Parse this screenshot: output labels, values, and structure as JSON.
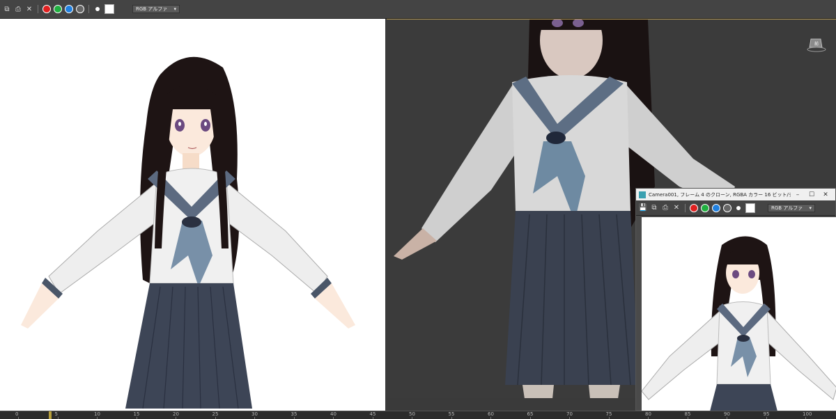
{
  "left_toolbar": {
    "dropdown_label": "RGB アルファ",
    "swatches": [
      "#e02020",
      "#20b040",
      "#2080e0"
    ]
  },
  "float_window": {
    "title": "Camera001, フレーム 4 のクローン, RGBA カラー 16 ビット/チ...",
    "dropdown_label": "RGB アルファ",
    "minimize": "–",
    "maximize": "☐",
    "close": "✕"
  },
  "viewport": {
    "viewcube_label": "前"
  },
  "timeline": {
    "ticks": [
      "0",
      "5",
      "10",
      "15",
      "20",
      "25",
      "30",
      "35",
      "40",
      "45",
      "50",
      "55",
      "60",
      "65",
      "70",
      "75",
      "80",
      "85",
      "90",
      "95",
      "100"
    ]
  },
  "colors": {
    "viewport_bg": "#3b3b3b",
    "toolbar_bg": "#444444",
    "timeline_bg": "#2c2c2c",
    "slider": "#b8a03c"
  }
}
